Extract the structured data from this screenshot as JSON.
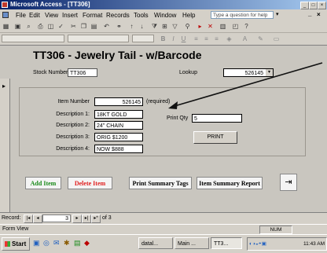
{
  "window": {
    "title": "Microsoft Access - [TT306]",
    "controls": [
      "_",
      "□",
      "×"
    ]
  },
  "menubar": {
    "items": [
      "File",
      "Edit",
      "View",
      "Insert",
      "Format",
      "Records",
      "Tools",
      "Window",
      "Help"
    ],
    "help_placeholder": "Type a question for help",
    "window_controls": [
      "_",
      "×"
    ]
  },
  "form": {
    "title": "TT306 - Jewelry Tail - w/Barcode",
    "stock_number_label": "Stock Number",
    "stock_number_value": "TT306",
    "lookup_label": "Lookup",
    "lookup_value": "526145",
    "item_number_label": "Item Number",
    "item_number_value": "526145",
    "required_note": "(required)",
    "desc1_label": "Description 1:",
    "desc1_value": "18KT GOLD",
    "desc2_label": "Description 2:",
    "desc2_value": "24\" CHAIN",
    "desc3_label": "Description 3:",
    "desc3_value": "ORIG $1200",
    "desc4_label": "Description 4:",
    "desc4_value": "NOW $888",
    "print_qty_label": "Print Qty",
    "print_qty_value": "5",
    "print_button": "PRINT",
    "add_item": "Add Item",
    "delete_item": "Delete Item",
    "print_summary_tags": "Print Summary Tags",
    "item_summary_report": "Item Summary Report"
  },
  "record_nav": {
    "label": "Record:",
    "current": "3",
    "of_text": "of 3"
  },
  "status": {
    "view": "Form View",
    "num": "NUM"
  },
  "taskbar": {
    "start": "Start",
    "tasks": [
      "datal...",
      "Main ...",
      "TT3..."
    ],
    "time": "11:43 AM"
  },
  "colors": {
    "title_bar": "#0a246a",
    "title_bar_end": "#a6caf0",
    "green_label": "#1a8a1a",
    "red_label": "#e02020",
    "arrow": "#111111"
  }
}
